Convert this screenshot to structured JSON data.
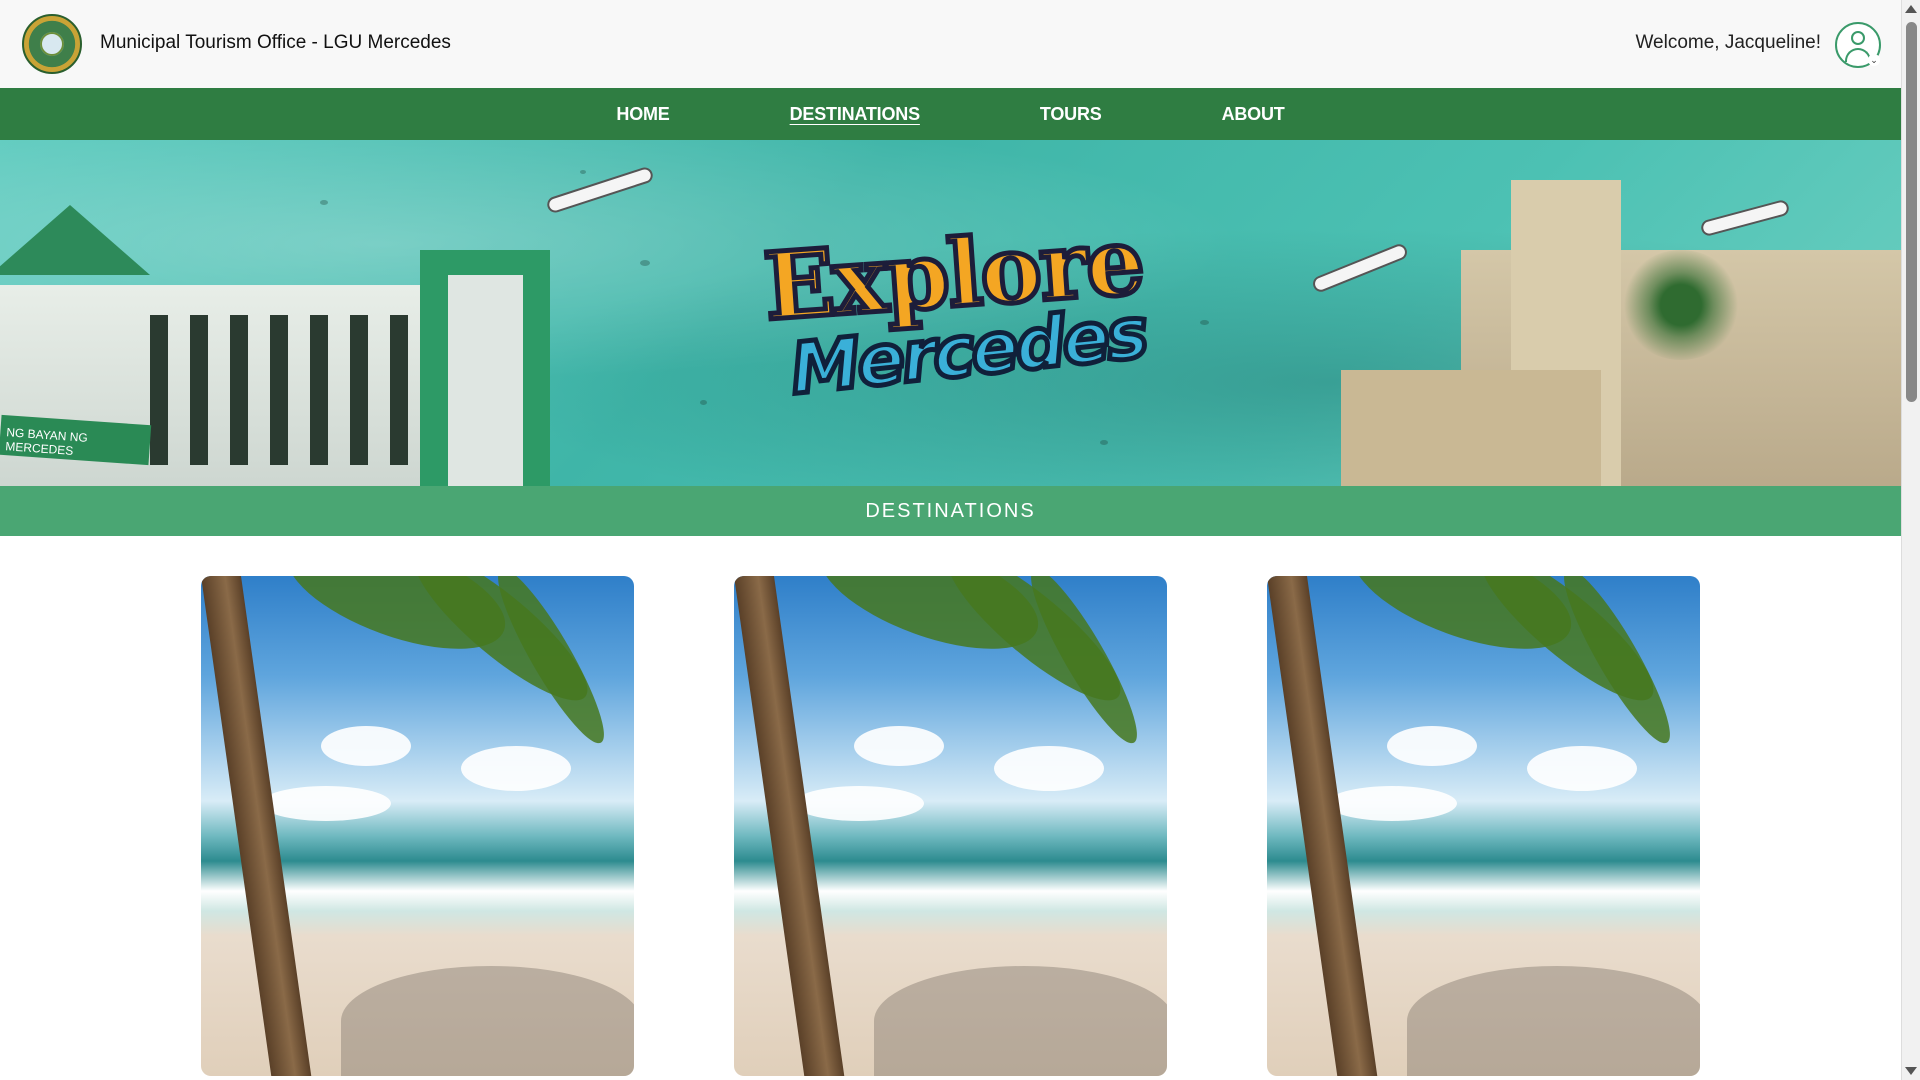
{
  "header": {
    "org_name": "Municipal Tourism Office - LGU Mercedes",
    "welcome": "Welcome, Jacqueline!",
    "logo_icon": "municipal-seal-logo",
    "avatar_icon": "user-avatar-icon"
  },
  "nav": {
    "items": [
      {
        "label": "HOME"
      },
      {
        "label": "DESTINATIONS",
        "active": true
      },
      {
        "label": "TOURS"
      },
      {
        "label": "ABOUT"
      }
    ]
  },
  "hero": {
    "line1": "Explore",
    "line2": "Mercedes",
    "building_sign": "NG BAYAN NG MERCEDES"
  },
  "section": {
    "title": "DESTINATIONS"
  },
  "destinations": [
    {
      "image": "beach-palm-image"
    },
    {
      "image": "beach-palm-image"
    },
    {
      "image": "beach-palm-image"
    }
  ],
  "colors": {
    "nav_green": "#2f7d42",
    "section_green": "#4aa673",
    "header_bg": "#f8f8f8"
  }
}
